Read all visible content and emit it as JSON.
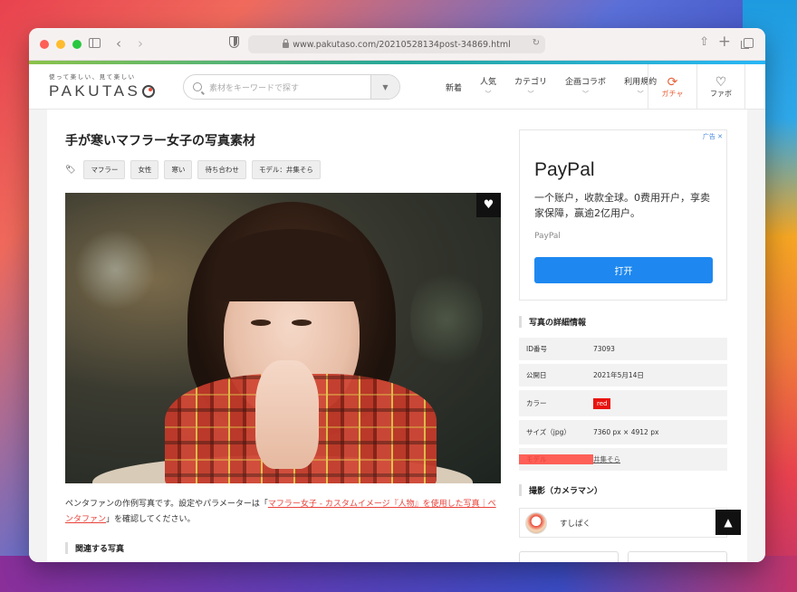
{
  "browser": {
    "url": "www.pakutaso.com/20210528134post-34869.html"
  },
  "site": {
    "logo_tagline": "使って楽しい、見て楽しい",
    "logo_text": "PAKUTAS",
    "search_placeholder": "素材をキーワードで探す",
    "nav": [
      {
        "label": "新着",
        "chevron": false
      },
      {
        "label": "人気",
        "chevron": true
      },
      {
        "label": "カテゴリ",
        "chevron": true
      },
      {
        "label": "企画コラボ",
        "chevron": true
      },
      {
        "label": "利用規約",
        "chevron": true
      }
    ],
    "gacha_label": "ガチャ",
    "fav_label": "ファボ"
  },
  "article": {
    "title": "手が寒いマフラー女子の写真素材",
    "tags": [
      "マフラー",
      "女性",
      "寒い",
      "待ち合わせ",
      "モデル：井集そら"
    ],
    "desc_prefix": "ペンタファンの作例写真です。設定やパラメーターは「",
    "desc_link": "マフラー女子 - カスタムイメージ『人物』を使用した写真｜ペンタファン",
    "desc_suffix": "」を確認してください。",
    "related_heading": "関連する写真"
  },
  "ad": {
    "badge": "广告",
    "title": "PayPal",
    "text": "一个账户，收款全球。0费用开户，享卖家保障，赢逾2亿用户。",
    "brand": "PayPal",
    "cta": "打开"
  },
  "details": {
    "heading": "写真の詳細情報",
    "rows": [
      {
        "key": "ID番号",
        "value": "73093"
      },
      {
        "key": "公開日",
        "value": "2021年5月14日"
      },
      {
        "key": "カラー",
        "value": "red"
      },
      {
        "key": "サイズ（jpg）",
        "value": "7360 px × 4912 px"
      },
      {
        "key": "モデル",
        "value": "井集そら"
      }
    ],
    "colors": {
      "chip": "#e8130f",
      "model_key": "#e8423a"
    }
  },
  "cameraman": {
    "heading": "撮影（カメラマン）",
    "name": "すしぱく"
  }
}
